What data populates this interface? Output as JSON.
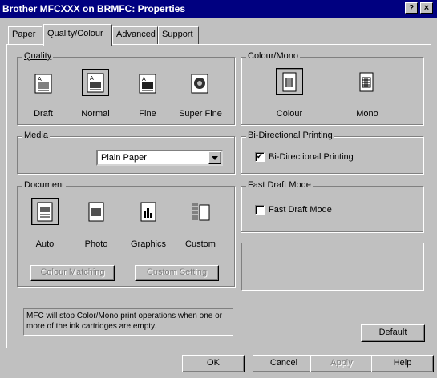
{
  "window": {
    "title": "Brother MFCXXX on BRMFC: Properties",
    "help_label": "?",
    "close_label": "×"
  },
  "tabs": [
    {
      "label": "Paper"
    },
    {
      "label": "Quality/Colour"
    },
    {
      "label": "Advanced"
    },
    {
      "label": "Support"
    }
  ],
  "quality": {
    "legend": "Quality",
    "options": [
      {
        "label": "Draft"
      },
      {
        "label": "Normal"
      },
      {
        "label": "Fine"
      },
      {
        "label": "Super Fine"
      }
    ],
    "selected": "Normal"
  },
  "colour_mono": {
    "legend": "Colour/Mono",
    "options": [
      {
        "label": "Colour"
      },
      {
        "label": "Mono"
      }
    ],
    "selected": "Colour"
  },
  "media": {
    "legend": "Media",
    "value": "Plain Paper"
  },
  "bidirectional": {
    "legend": "Bi-Directional Printing",
    "label": "Bi-Directional Printing",
    "checked": true
  },
  "document": {
    "legend": "Document",
    "options": [
      {
        "label": "Auto"
      },
      {
        "label": "Photo"
      },
      {
        "label": "Graphics"
      },
      {
        "label": "Custom"
      }
    ],
    "selected": "Auto",
    "colour_matching_label": "Colour Matching",
    "custom_setting_label": "Custom Setting"
  },
  "fast_draft": {
    "legend": "Fast Draft Mode",
    "label": "Fast Draft Mode",
    "checked": false
  },
  "info_text": "MFC will stop Color/Mono print operations when one or more of the ink cartridges are empty.",
  "buttons": {
    "default": "Default",
    "ok": "OK",
    "cancel": "Cancel",
    "apply": "Apply",
    "help": "Help"
  },
  "check_mark": "✓"
}
